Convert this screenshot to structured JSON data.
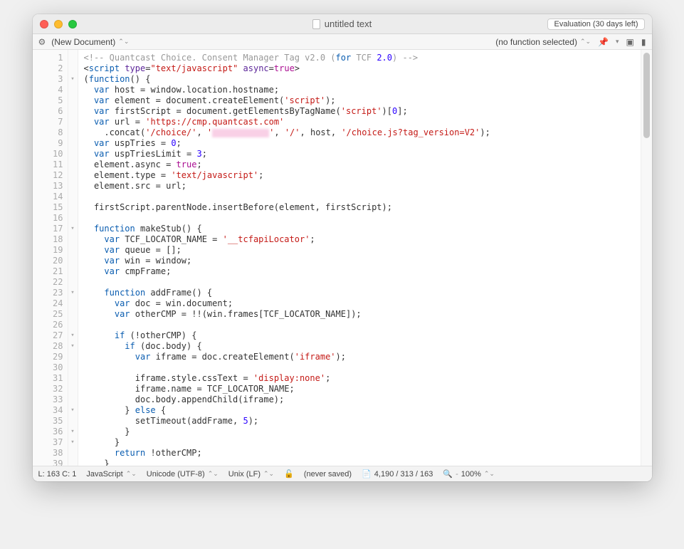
{
  "titlebar": {
    "title": "untitled text",
    "eval_badge": "Evaluation (30 days left)"
  },
  "toolbar": {
    "document_label": "(New Document)",
    "function_label": "(no function selected)"
  },
  "gutter": {
    "start": 1,
    "end": 39
  },
  "fold": {
    "3": "▼",
    "17": "▼",
    "23": "▼",
    "27": "▼",
    "28": "▼",
    "34": "▾",
    "36": "└",
    "37": "└"
  },
  "code": [
    {
      "n": 1,
      "html": "<span class='c-comment'>&lt;!-- Quantcast Choice. Consent Manager Tag v2.0 (</span><span class='c-keyword'>for</span><span class='c-comment'> TCF </span><span class='c-number'>2.0</span><span class='c-comment'>) --&gt;</span>"
    },
    {
      "n": 2,
      "html": "&lt;<span class='c-tag'>script</span> <span class='c-attr'>type</span>=<span class='c-val'>\"text/javascript\"</span> <span class='c-attr'>async</span>=<span class='c-truefalse'>true</span>&gt;"
    },
    {
      "n": 3,
      "html": "(<span class='c-keyword'>function</span>() {"
    },
    {
      "n": 4,
      "html": "  <span class='c-keyword'>var</span> host = window.location.hostname;"
    },
    {
      "n": 5,
      "html": "  <span class='c-keyword'>var</span> element = document.createElement(<span class='c-string'>'script'</span>);"
    },
    {
      "n": 6,
      "html": "  <span class='c-keyword'>var</span> firstScript = document.getElementsByTagName(<span class='c-string'>'script'</span>)[<span class='c-number'>0</span>];"
    },
    {
      "n": 7,
      "html": "  <span class='c-keyword'>var</span> url = <span class='c-string'>'https://cmp.quantcast.com'</span>"
    },
    {
      "n": 8,
      "html": "    .concat(<span class='c-string'>'/choice/'</span>, <span class='c-string'>'</span><span class='blurred'></span><span class='c-string'>'</span>, <span class='c-string'>'/'</span>, host, <span class='c-string'>'/choice.js?tag_version=V2'</span>);"
    },
    {
      "n": 9,
      "html": "  <span class='c-keyword'>var</span> uspTries = <span class='c-number'>0</span>;"
    },
    {
      "n": 10,
      "html": "  <span class='c-keyword'>var</span> uspTriesLimit = <span class='c-number'>3</span>;"
    },
    {
      "n": 11,
      "html": "  element.async = <span class='c-truefalse'>true</span>;"
    },
    {
      "n": 12,
      "html": "  element.type = <span class='c-string'>'text/javascript'</span>;"
    },
    {
      "n": 13,
      "html": "  element.src = url;"
    },
    {
      "n": 14,
      "html": ""
    },
    {
      "n": 15,
      "html": "  firstScript.parentNode.insertBefore(element, firstScript);"
    },
    {
      "n": 16,
      "html": ""
    },
    {
      "n": 17,
      "html": "  <span class='c-keyword'>function</span> makeStub() {"
    },
    {
      "n": 18,
      "html": "    <span class='c-keyword'>var</span> TCF_LOCATOR_NAME = <span class='c-string'>'__tcfapiLocator'</span>;"
    },
    {
      "n": 19,
      "html": "    <span class='c-keyword'>var</span> queue = [];"
    },
    {
      "n": 20,
      "html": "    <span class='c-keyword'>var</span> win = window;"
    },
    {
      "n": 21,
      "html": "    <span class='c-keyword'>var</span> cmpFrame;"
    },
    {
      "n": 22,
      "html": ""
    },
    {
      "n": 23,
      "html": "    <span class='c-keyword'>function</span> addFrame() {"
    },
    {
      "n": 24,
      "html": "      <span class='c-keyword'>var</span> doc = win.document;"
    },
    {
      "n": 25,
      "html": "      <span class='c-keyword'>var</span> otherCMP = !!(win.frames[TCF_LOCATOR_NAME]);"
    },
    {
      "n": 26,
      "html": ""
    },
    {
      "n": 27,
      "html": "      <span class='c-keyword'>if</span> (!otherCMP) {"
    },
    {
      "n": 28,
      "html": "        <span class='c-keyword'>if</span> (doc.body) {"
    },
    {
      "n": 29,
      "html": "          <span class='c-keyword'>var</span> iframe = doc.createElement(<span class='c-string'>'iframe'</span>);"
    },
    {
      "n": 30,
      "html": ""
    },
    {
      "n": 31,
      "html": "          iframe.style.cssText = <span class='c-string'>'display:none'</span>;"
    },
    {
      "n": 32,
      "html": "          iframe.name = TCF_LOCATOR_NAME;"
    },
    {
      "n": 33,
      "html": "          doc.body.appendChild(iframe);"
    },
    {
      "n": 34,
      "html": "        } <span class='c-keyword'>else</span> {"
    },
    {
      "n": 35,
      "html": "          setTimeout(addFrame, <span class='c-number'>5</span>);"
    },
    {
      "n": 36,
      "html": "        }"
    },
    {
      "n": 37,
      "html": "      }"
    },
    {
      "n": 38,
      "html": "      <span class='c-keyword'>return</span> !otherCMP;"
    },
    {
      "n": 39,
      "html": "    }"
    }
  ],
  "status": {
    "cursor": "L: 163 C: 1",
    "language": "JavaScript",
    "encoding": "Unicode (UTF-8)",
    "line_endings": "Unix (LF)",
    "lock": "🔓",
    "saved": "(never saved)",
    "stats": "4,190 / 313 / 163",
    "zoom": "100%"
  }
}
